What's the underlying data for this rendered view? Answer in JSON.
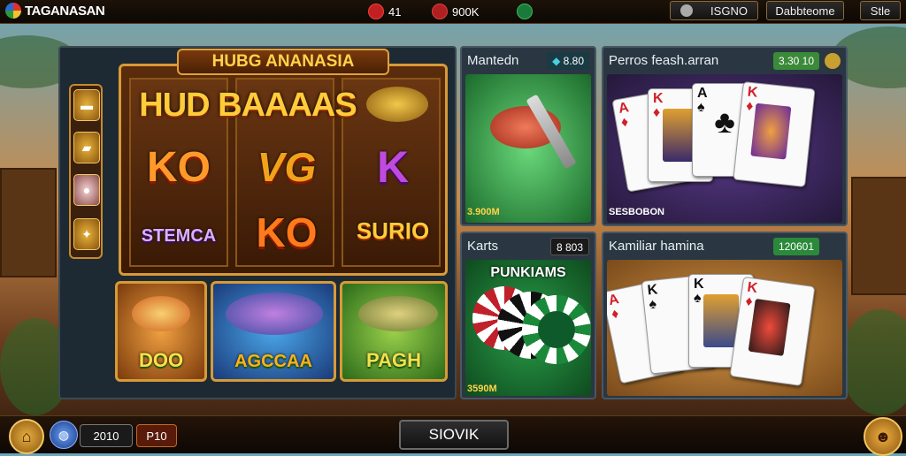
{
  "header": {
    "app_title": "TAGANASAN",
    "stat_1": "41",
    "stat_2": "900K",
    "btn_1_label": "ISGNO",
    "btn_2_label": "Dabbteome",
    "btn_3_label": "Stle"
  },
  "slot_game": {
    "banner": "HUBG ANANASIA",
    "headline": "HUD BAAAAS",
    "reel_symbols": [
      "KO",
      "VG",
      "K",
      "STEMCA",
      "KO",
      "SURIO"
    ],
    "fish_labels": [
      "DOO",
      "AGCCAA",
      "PAGH"
    ]
  },
  "tiles": [
    {
      "title": "Mantedn",
      "badge": "8.80",
      "footer": "3.900M"
    },
    {
      "title": "Perros feash.arran",
      "badge": "3.30 10",
      "footer": "SESBOBON"
    },
    {
      "title": "Karts",
      "badge": "8 803",
      "footer": "3590M",
      "art_label": "PUNKIAMS"
    },
    {
      "title": "Kamiliar hamina",
      "badge": "120601"
    }
  ],
  "footer": {
    "counter_1": "2010",
    "counter_2": "P10",
    "center_button": "SIOVIK"
  },
  "colors": {
    "gold": "#d79a36",
    "accent_yellow": "#ffd34a",
    "badge_green": "#3a8a3a",
    "badge_teal": "#2a8a7a",
    "card_red": "#d0202a",
    "felt_green": "#1f7a3a",
    "felt_purple": "#3a2a5a"
  },
  "icons": [
    "logo-icon",
    "heart-icon",
    "shield-icon",
    "gem-icon",
    "clock-icon",
    "home-icon",
    "globe-icon",
    "avatar-icon",
    "gold-bar-icon",
    "fish-icon"
  ]
}
